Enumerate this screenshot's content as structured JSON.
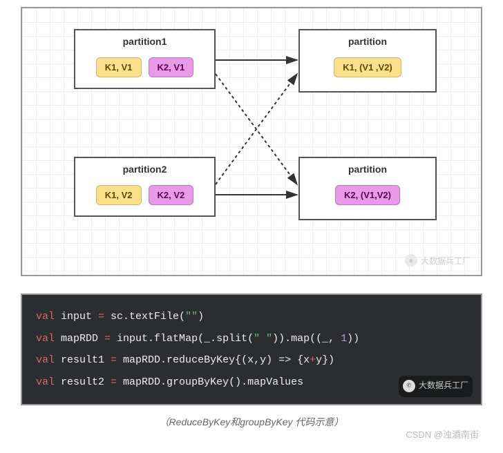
{
  "diagram": {
    "partitions": {
      "p1": {
        "title": "partition1",
        "kvs": [
          {
            "text": "K1, V1",
            "cls": "yellow"
          },
          {
            "text": "K2, V1",
            "cls": "pink"
          }
        ]
      },
      "p2": {
        "title": "partition2",
        "kvs": [
          {
            "text": "K1, V2",
            "cls": "yellow"
          },
          {
            "text": "K2, V2",
            "cls": "pink"
          }
        ]
      },
      "r1": {
        "title": "partition",
        "kvs": [
          {
            "text": "K1, (V1 ,V2)",
            "cls": "yellow"
          }
        ]
      },
      "r2": {
        "title": "partition",
        "kvs": [
          {
            "text": "K2, (V1,V2)",
            "cls": "pink"
          }
        ]
      }
    },
    "arrows": [
      {
        "from": "p1",
        "to": "r1",
        "style": "solid"
      },
      {
        "from": "p1",
        "to": "r2",
        "style": "dotted"
      },
      {
        "from": "p2",
        "to": "r1",
        "style": "dotted"
      },
      {
        "from": "p2",
        "to": "r2",
        "style": "solid"
      }
    ],
    "watermark": "大数据兵工厂"
  },
  "code": {
    "lines": [
      [
        {
          "t": "val ",
          "c": "tok-kw"
        },
        {
          "t": "input ",
          "c": "tok-plain"
        },
        {
          "t": "= ",
          "c": "tok-op"
        },
        {
          "t": "sc.textFile(",
          "c": "tok-plain"
        },
        {
          "t": "\"\"",
          "c": "tok-str"
        },
        {
          "t": ")",
          "c": "tok-plain"
        }
      ],
      [
        {
          "t": "val ",
          "c": "tok-kw"
        },
        {
          "t": "mapRDD ",
          "c": "tok-plain"
        },
        {
          "t": "= ",
          "c": "tok-op"
        },
        {
          "t": "input.flatMap(_.split(",
          "c": "tok-plain"
        },
        {
          "t": "\" \"",
          "c": "tok-str"
        },
        {
          "t": ")).map((_, ",
          "c": "tok-plain"
        },
        {
          "t": "1",
          "c": "tok-num"
        },
        {
          "t": "))",
          "c": "tok-plain"
        }
      ],
      [
        {
          "t": "val ",
          "c": "tok-kw"
        },
        {
          "t": "result1 ",
          "c": "tok-plain"
        },
        {
          "t": "= ",
          "c": "tok-op"
        },
        {
          "t": "mapRDD.reduceByKey{(x,y) ",
          "c": "tok-plain"
        },
        {
          "t": "=>",
          "c": "tok-arrow"
        },
        {
          "t": " {x",
          "c": "tok-plain"
        },
        {
          "t": "+",
          "c": "tok-op"
        },
        {
          "t": "y})",
          "c": "tok-plain"
        }
      ],
      [
        {
          "t": "val ",
          "c": "tok-kw"
        },
        {
          "t": "result2 ",
          "c": "tok-plain"
        },
        {
          "t": "= ",
          "c": "tok-op"
        },
        {
          "t": "mapRDD.groupByKey().mapValues",
          "c": "tok-plain"
        }
      ]
    ],
    "watermark": "大数据兵工厂"
  },
  "caption": "（ReduceByKey和groupByKey 代码示意）",
  "csdn": "CSDN @浊酒南街",
  "chart_data": {
    "type": "table",
    "title": "GroupByKey shuffle diagram",
    "input_partitions": [
      {
        "name": "partition1",
        "pairs": [
          [
            "K1",
            "V1"
          ],
          [
            "K2",
            "V1"
          ]
        ]
      },
      {
        "name": "partition2",
        "pairs": [
          [
            "K1",
            "V2"
          ],
          [
            "K2",
            "V2"
          ]
        ]
      }
    ],
    "output_partitions": [
      {
        "name": "partition",
        "key": "K1",
        "values": [
          "V1",
          "V2"
        ]
      },
      {
        "name": "partition",
        "key": "K2",
        "values": [
          "V1",
          "V2"
        ]
      }
    ],
    "edges": [
      {
        "from": "partition1",
        "to": "K1",
        "style": "solid"
      },
      {
        "from": "partition1",
        "to": "K2",
        "style": "dotted"
      },
      {
        "from": "partition2",
        "to": "K1",
        "style": "dotted"
      },
      {
        "from": "partition2",
        "to": "K2",
        "style": "solid"
      }
    ]
  }
}
